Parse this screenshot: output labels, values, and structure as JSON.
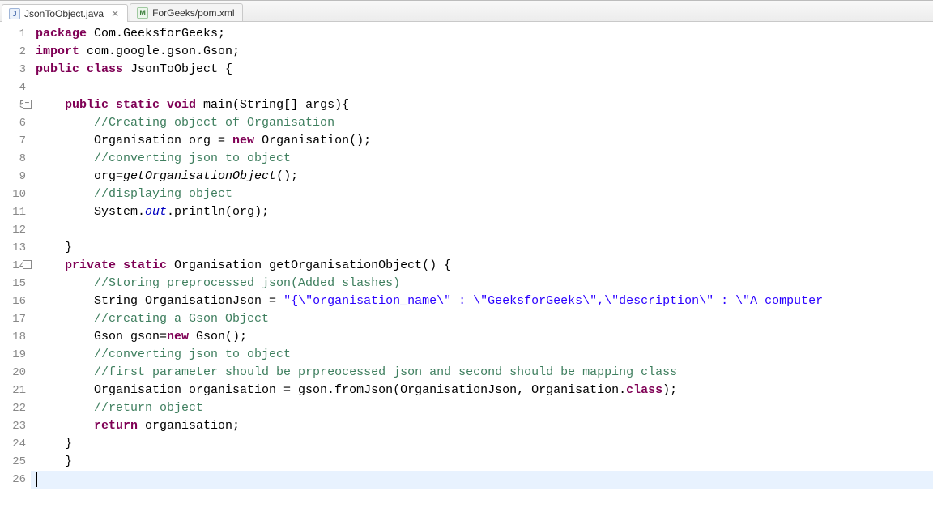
{
  "tabs": [
    {
      "label": "JsonToObject.java",
      "icon": "J",
      "active": true
    },
    {
      "label": "ForGeeks/pom.xml",
      "icon": "M",
      "active": false
    }
  ],
  "highlight_line": 26,
  "lines": [
    {
      "n": "1",
      "fold": "",
      "tokens": [
        [
          "kw",
          "package"
        ],
        [
          "pln",
          " Com.GeeksforGeeks;"
        ]
      ]
    },
    {
      "n": "2",
      "fold": "",
      "tokens": [
        [
          "kw",
          "import"
        ],
        [
          "pln",
          " com.google.gson.Gson;"
        ]
      ]
    },
    {
      "n": "3",
      "fold": "",
      "tokens": [
        [
          "kw",
          "public class"
        ],
        [
          "pln",
          " JsonToObject {"
        ]
      ]
    },
    {
      "n": "4",
      "fold": "",
      "tokens": [
        [
          "pln",
          ""
        ]
      ]
    },
    {
      "n": "5",
      "fold": "⊖",
      "tokens": [
        [
          "pln",
          "    "
        ],
        [
          "kw",
          "public static void"
        ],
        [
          "pln",
          " main(String[] args){"
        ]
      ]
    },
    {
      "n": "6",
      "fold": "",
      "tokens": [
        [
          "pln",
          "        "
        ],
        [
          "cm",
          "//Creating object of Organisation"
        ]
      ]
    },
    {
      "n": "7",
      "fold": "",
      "tokens": [
        [
          "pln",
          "        Organisation org = "
        ],
        [
          "kw",
          "new"
        ],
        [
          "pln",
          " Organisation();"
        ]
      ]
    },
    {
      "n": "8",
      "fold": "",
      "tokens": [
        [
          "pln",
          "        "
        ],
        [
          "cm",
          "//converting json to object"
        ]
      ]
    },
    {
      "n": "9",
      "fold": "",
      "tokens": [
        [
          "pln",
          "        org="
        ],
        [
          "mth",
          "getOrganisationObject"
        ],
        [
          "pln",
          "();"
        ]
      ]
    },
    {
      "n": "10",
      "fold": "",
      "tokens": [
        [
          "pln",
          "        "
        ],
        [
          "cm",
          "//displaying object"
        ]
      ]
    },
    {
      "n": "11",
      "fold": "",
      "tokens": [
        [
          "pln",
          "        System."
        ],
        [
          "fld",
          "out"
        ],
        [
          "pln",
          ".println(org);"
        ]
      ]
    },
    {
      "n": "12",
      "fold": "",
      "tokens": [
        [
          "pln",
          ""
        ]
      ]
    },
    {
      "n": "13",
      "fold": "",
      "tokens": [
        [
          "pln",
          "    }"
        ]
      ]
    },
    {
      "n": "14",
      "fold": "⊖",
      "tokens": [
        [
          "pln",
          "    "
        ],
        [
          "kw",
          "private static"
        ],
        [
          "pln",
          " Organisation getOrganisationObject() {"
        ]
      ]
    },
    {
      "n": "15",
      "fold": "",
      "tokens": [
        [
          "pln",
          "        "
        ],
        [
          "cm",
          "//Storing preprocessed json(Added slashes)"
        ]
      ]
    },
    {
      "n": "16",
      "fold": "",
      "tokens": [
        [
          "pln",
          "        String OrganisationJson = "
        ],
        [
          "str",
          "\"{\\\"organisation_name\\\" : \\\"GeeksforGeeks\\\",\\\"description\\\" : \\\"A computer"
        ]
      ]
    },
    {
      "n": "17",
      "fold": "",
      "tokens": [
        [
          "pln",
          "        "
        ],
        [
          "cm",
          "//creating a Gson Object"
        ]
      ]
    },
    {
      "n": "18",
      "fold": "",
      "tokens": [
        [
          "pln",
          "        Gson gson="
        ],
        [
          "kw",
          "new"
        ],
        [
          "pln",
          " Gson();"
        ]
      ]
    },
    {
      "n": "19",
      "fold": "",
      "tokens": [
        [
          "pln",
          "        "
        ],
        [
          "cm",
          "//converting json to object"
        ]
      ]
    },
    {
      "n": "20",
      "fold": "",
      "tokens": [
        [
          "pln",
          "        "
        ],
        [
          "cm",
          "//first parameter should be prpreocessed json and second should be mapping class"
        ]
      ]
    },
    {
      "n": "21",
      "fold": "",
      "tokens": [
        [
          "pln",
          "        Organisation organisation = gson.fromJson(OrganisationJson, Organisation."
        ],
        [
          "kw",
          "class"
        ],
        [
          "pln",
          ");"
        ]
      ]
    },
    {
      "n": "22",
      "fold": "",
      "tokens": [
        [
          "pln",
          "        "
        ],
        [
          "cm",
          "//return object"
        ]
      ]
    },
    {
      "n": "23",
      "fold": "",
      "tokens": [
        [
          "pln",
          "        "
        ],
        [
          "kw",
          "return"
        ],
        [
          "pln",
          " organisation;"
        ]
      ]
    },
    {
      "n": "24",
      "fold": "",
      "tokens": [
        [
          "pln",
          "    }"
        ]
      ]
    },
    {
      "n": "25",
      "fold": "",
      "tokens": [
        [
          "pln",
          "    }"
        ]
      ]
    },
    {
      "n": "26",
      "fold": "",
      "tokens": [
        [
          "pln",
          ""
        ]
      ]
    }
  ]
}
